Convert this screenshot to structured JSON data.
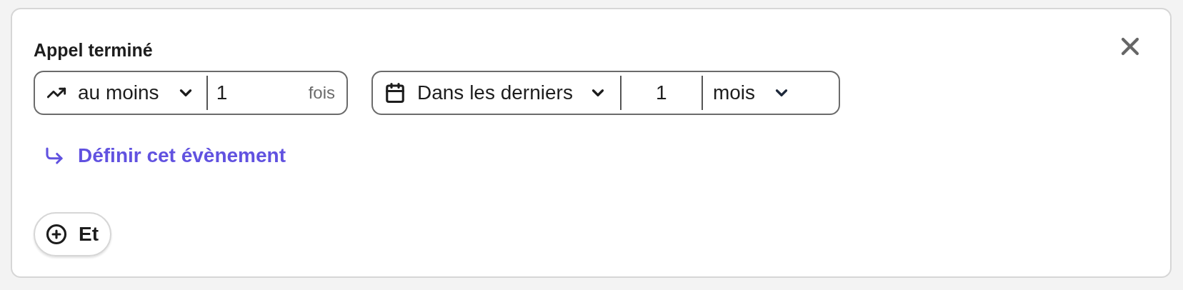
{
  "title": "Appel terminé",
  "frequency": {
    "operator": "au moins",
    "count": "1",
    "unit": "fois"
  },
  "period": {
    "operator": "Dans les derniers",
    "count": "1",
    "unit": "mois"
  },
  "define_link": "Définir cet évènement",
  "and_button": "Et"
}
